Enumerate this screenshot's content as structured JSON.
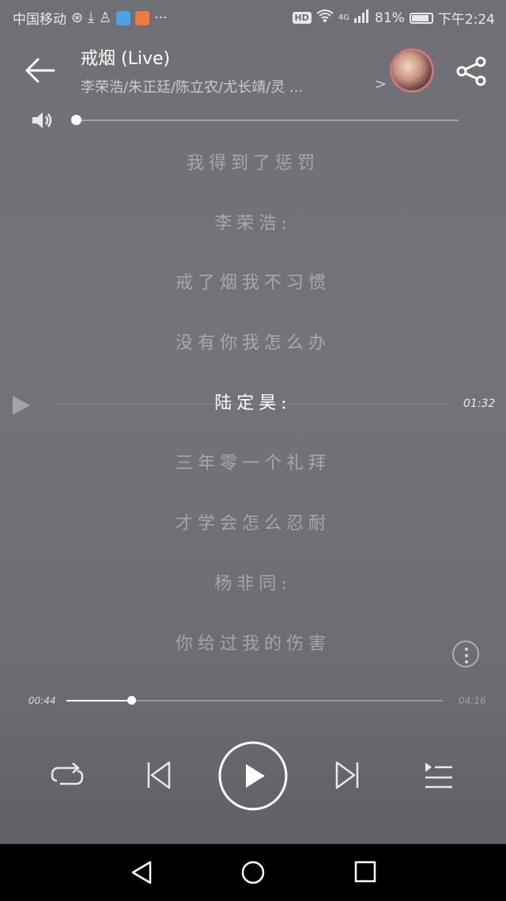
{
  "status_bar": {
    "carrier": "中国移动",
    "more_glyph": "···",
    "hd": "HD",
    "signal": "4G",
    "battery": "81%",
    "time": "下午2:24"
  },
  "header": {
    "title": "戒烟 (Live)",
    "artists": "李荣浩/朱正廷/陈立农/尤长靖/灵 ...",
    "chevron": ">"
  },
  "volume": {
    "level": 0.0
  },
  "lyrics": [
    {
      "text": "我得到了惩罚",
      "current": false
    },
    {
      "text": "李荣浩:",
      "current": false
    },
    {
      "text": "戒了烟我不习惯",
      "current": false
    },
    {
      "text": "没有你我怎么办",
      "current": false
    },
    {
      "text": "陆定昊:",
      "current": true
    },
    {
      "text": "三年零一个礼拜",
      "current": false
    },
    {
      "text": "才学会怎么忍耐",
      "current": false
    },
    {
      "text": "杨非同:",
      "current": false
    },
    {
      "text": "你给过我的伤害",
      "current": false
    }
  ],
  "seek_preview_time": "01:32",
  "progress": {
    "current": "00:44",
    "total": "04:16",
    "fraction": 0.172
  },
  "colors": {
    "background": "#707177",
    "navbar": "#000000"
  }
}
